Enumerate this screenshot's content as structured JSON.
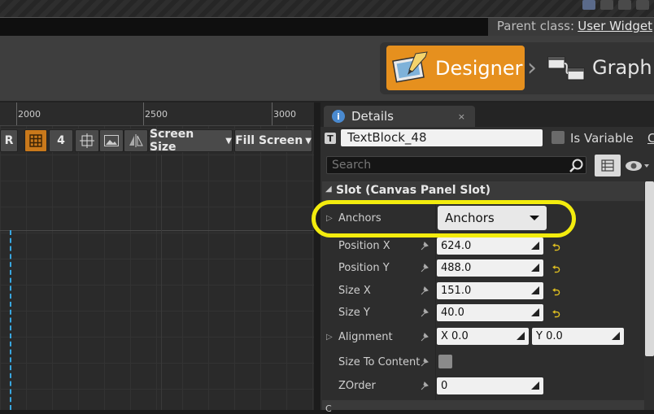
{
  "header": {
    "parent_class_label": "Parent class:",
    "parent_class_value": "User Widget"
  },
  "modes": {
    "designer_label": "Designer",
    "graph_label": "Graph",
    "active": "Designer"
  },
  "canvas": {
    "ruler_ticks": [
      "2000",
      "2500",
      "3000"
    ],
    "toolbar": {
      "r_label": "R",
      "grid_snap_value": "4",
      "screen_size_label": "Screen Size",
      "fill_screen_label": "Fill Screen"
    }
  },
  "details": {
    "tab_label": "Details",
    "tab_close": "×",
    "widget_name": "TextBlock_48",
    "is_variable_label": "Is Variable",
    "truncated_label": "C",
    "search_placeholder": "Search",
    "section_title": "Slot (Canvas Panel Slot)",
    "properties": {
      "anchors_label": "Anchors",
      "anchors_value": "Anchors",
      "position_x_label": "Position X",
      "position_x_value": "624.0",
      "position_y_label": "Position Y",
      "position_y_value": "488.0",
      "size_x_label": "Size X",
      "size_x_value": "151.0",
      "size_y_label": "Size Y",
      "size_y_value": "40.0",
      "alignment_label": "Alignment",
      "alignment_x": "X  0.0",
      "alignment_y": "Y  0.0",
      "size_to_content_label": "Size To Content",
      "zorder_label": "ZOrder",
      "zorder_value": "0"
    },
    "next_section_partial": "C"
  },
  "colors": {
    "accent_orange": "#e6901e",
    "highlight_yellow": "#f3ec0e",
    "selection_blue": "#39a7e0"
  }
}
